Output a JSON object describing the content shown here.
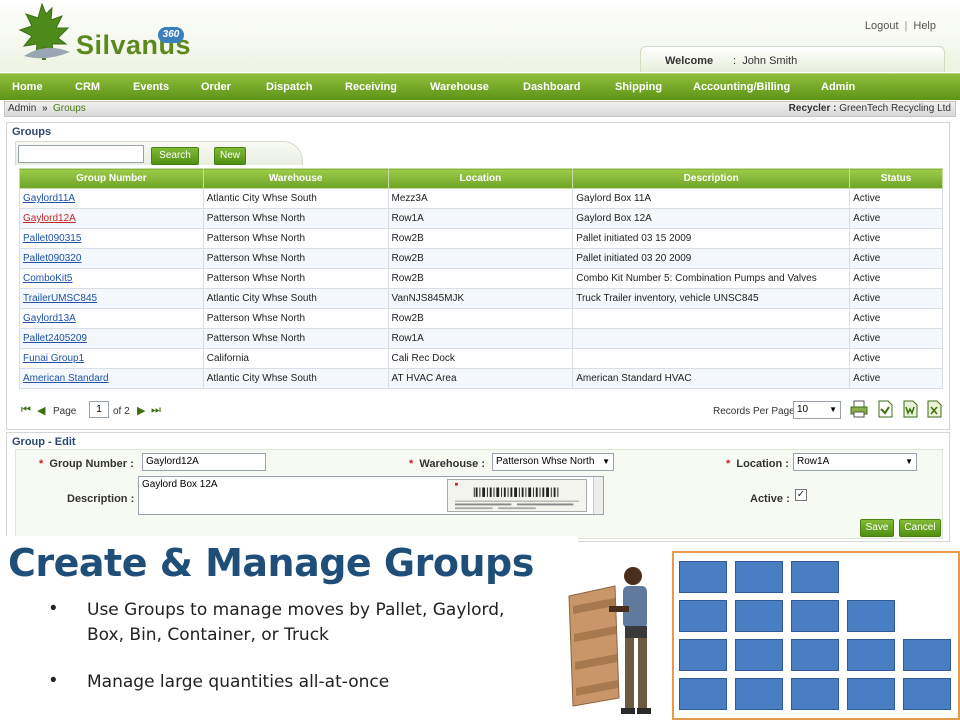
{
  "brand": {
    "name": "Silvanus",
    "badge": "360"
  },
  "top_links": {
    "logout": "Logout",
    "separator": "|",
    "help": "Help"
  },
  "welcome": {
    "label": "Welcome",
    "separator": ":",
    "user": "John Smith"
  },
  "nav": [
    "Home",
    "CRM",
    "Events",
    "Order",
    "Dispatch",
    "Receiving",
    "Warehouse",
    "Dashboard",
    "Shipping",
    "Accounting/Billing",
    "Admin"
  ],
  "breadcrumb": {
    "root": "Admin",
    "current": "Groups"
  },
  "recycler": {
    "label": "Recycler :",
    "value": "GreenTech Recycling Ltd"
  },
  "groups": {
    "title": "Groups",
    "search_value": "",
    "search_label": "Search",
    "new_label": "New",
    "columns": [
      "Group Number",
      "Warehouse",
      "Location",
      "Description",
      "Status"
    ],
    "rows": [
      [
        "Gaylord11A",
        "Atlantic City Whse South",
        "Mezz3A",
        "Gaylord Box 11A",
        "Active"
      ],
      [
        "Gaylord12A",
        "Patterson Whse North",
        "Row1A",
        "Gaylord Box 12A",
        "Active"
      ],
      [
        "Pallet090315",
        "Patterson Whse North",
        "Row2B",
        "Pallet initiated 03 15 2009",
        "Active"
      ],
      [
        "Pallet090320",
        "Patterson Whse North",
        "Row2B",
        "Pallet initiated 03 20 2009",
        "Active"
      ],
      [
        "ComboKit5",
        "Patterson Whse North",
        "Row2B",
        "Combo Kit Number 5: Combination Pumps and Valves",
        "Active"
      ],
      [
        "TrailerUMSC845",
        "Atlantic City Whse South",
        "VanNJS845MJK",
        "Truck Trailer inventory, vehicle UNSC845",
        "Active"
      ],
      [
        "Gaylord13A",
        "Patterson Whse North",
        "Row2B",
        "",
        "Active"
      ],
      [
        "Pallet2405209",
        "Patterson Whse North",
        "Row1A",
        "",
        "Active"
      ],
      [
        "Funai Group1",
        "California",
        "Cali Rec Dock",
        "",
        "Active"
      ],
      [
        "American Standard",
        "Atlantic City Whse South",
        "AT HVAC Area",
        "American Standard HVAC",
        "Active"
      ]
    ],
    "selected_row": 1,
    "pager": {
      "page_label": "Page",
      "page": "1",
      "of_label": "of 2",
      "records_label": "Records Per Page",
      "records_per_page": "10"
    }
  },
  "edit": {
    "title": "Group - Edit",
    "required_mark": "*",
    "group_number_label": "Group Number :",
    "group_number": "Gaylord12A",
    "warehouse_label": "Warehouse :",
    "warehouse": "Patterson Whse North",
    "location_label": "Location :",
    "location": "Row1A",
    "description_label": "Description :",
    "description": "Gaylord Box 12A",
    "active_label": "Active :",
    "active": true,
    "check_mark": "✓",
    "save_label": "Save",
    "cancel_label": "Cancel"
  },
  "slide": {
    "title": "Create & Manage Groups",
    "bullets": [
      "Use Groups to manage moves by Pallet, Gaylord, Box, Bin, Container, or Truck",
      "Manage large quantities all-at-once"
    ]
  },
  "colors": {
    "brand_green": "#5a8a1f",
    "nav_green": "#6fa326",
    "title_blue": "#1f4e79",
    "box_blue": "#4a7ec3",
    "frame_orange": "#e59a4c"
  }
}
